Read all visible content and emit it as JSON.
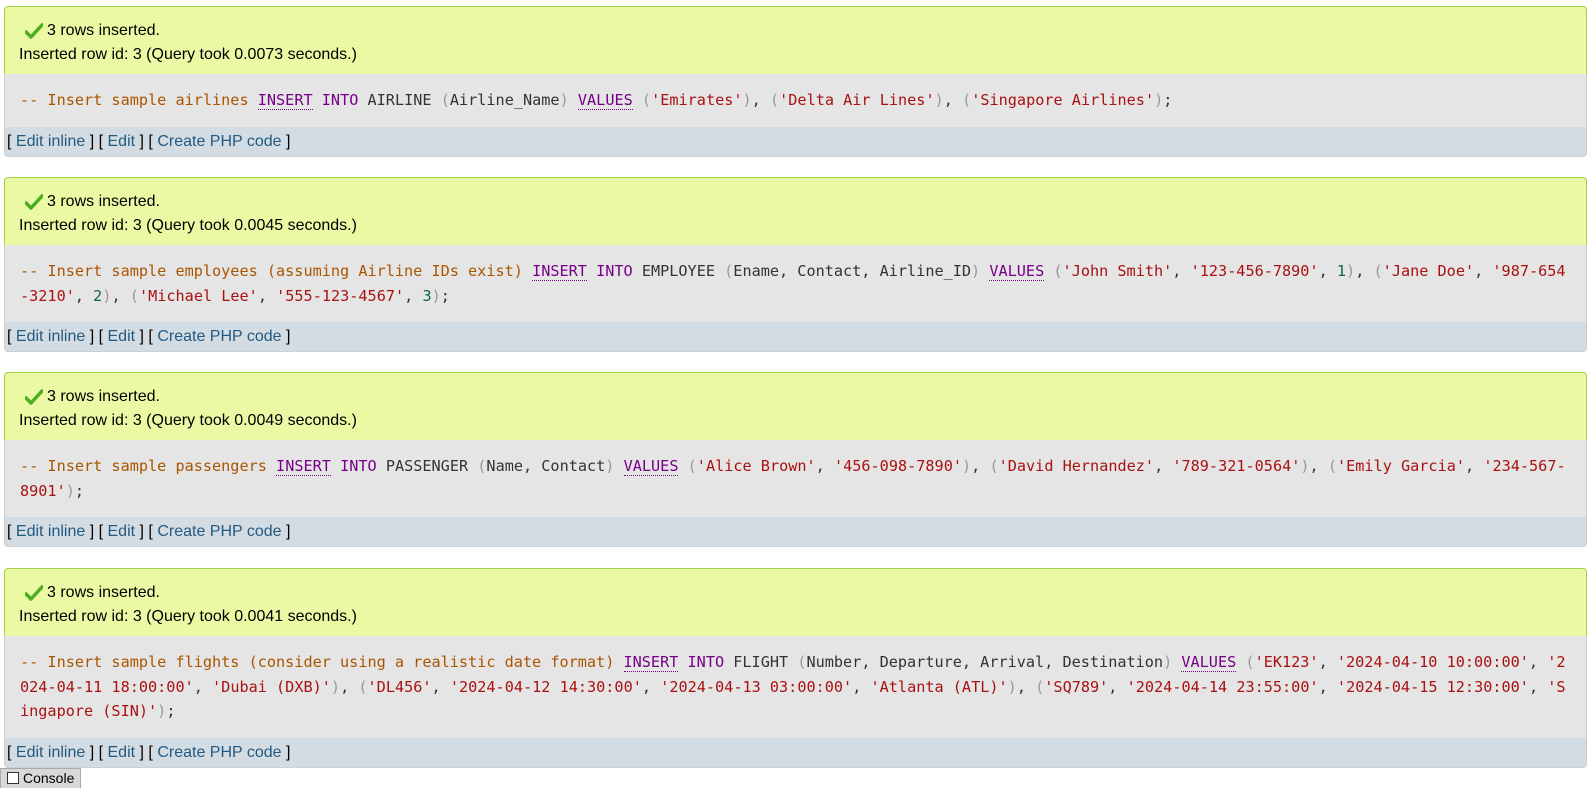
{
  "colors": {
    "success_bg": "#ebf8a4",
    "success_border": "#a2d246",
    "sql_bg": "#e5e5e5",
    "links_bg": "#d3dce3",
    "link": "#235a81",
    "comment": "#aa5500",
    "keyword": "#770088",
    "string": "#aa1111",
    "number": "#116644"
  },
  "results": [
    {
      "message": "3 rows inserted.",
      "detail": "Inserted row id: 3 (Query took 0.0073 seconds.)",
      "sql": {
        "comment": "-- Insert sample airlines",
        "insert": "INSERT",
        "into": "INTO",
        "table": "AIRLINE",
        "columns": "Airline_Name",
        "values_kw": "VALUES",
        "rows": [
          [
            "'Emirates'"
          ],
          [
            "'Delta Air Lines'"
          ],
          [
            "'Singapore Airlines'"
          ]
        ]
      },
      "links": [
        "Edit inline",
        "Edit",
        "Create PHP code"
      ]
    },
    {
      "message": "3 rows inserted.",
      "detail": "Inserted row id: 3 (Query took 0.0045 seconds.)",
      "sql": {
        "comment": "-- Insert sample employees (assuming Airline IDs exist)",
        "insert": "INSERT",
        "into": "INTO",
        "table": "EMPLOYEE",
        "columns": "Ename, Contact, Airline_ID",
        "values_kw": "VALUES",
        "rows": [
          [
            "'John Smith'",
            "'123-456-7890'",
            "1"
          ],
          [
            "'Jane Doe'",
            "'987-654-3210'",
            "2"
          ],
          [
            "'Michael Lee'",
            "'555-123-4567'",
            "3"
          ]
        ]
      },
      "links": [
        "Edit inline",
        "Edit",
        "Create PHP code"
      ]
    },
    {
      "message": "3 rows inserted.",
      "detail": "Inserted row id: 3 (Query took 0.0049 seconds.)",
      "sql": {
        "comment": "-- Insert sample passengers",
        "insert": "INSERT",
        "into": "INTO",
        "table": "PASSENGER",
        "columns": "Name, Contact",
        "values_kw": "VALUES",
        "rows": [
          [
            "'Alice Brown'",
            "'456-098-7890'"
          ],
          [
            "'David Hernandez'",
            "'789-321-0564'"
          ],
          [
            "'Emily Garcia'",
            "'234-567-8901'"
          ]
        ]
      },
      "links": [
        "Edit inline",
        "Edit",
        "Create PHP code"
      ]
    },
    {
      "message": "3 rows inserted.",
      "detail": "Inserted row id: 3 (Query took 0.0041 seconds.)",
      "sql": {
        "comment": "-- Insert sample flights (consider using a realistic date format)",
        "insert": "INSERT",
        "into": "INTO",
        "table": "FLIGHT",
        "columns": "Number, Departure, Arrival, Destination",
        "values_kw": "VALUES",
        "rows": [
          [
            "'EK123'",
            "'2024-04-10 10:00:00'",
            "'2024-04-11 18:00:00'",
            "'Dubai (DXB)'"
          ],
          [
            "'DL456'",
            "'2024-04-12 14:30:00'",
            "'2024-04-13 03:00:00'",
            "'Atlanta (ATL)'"
          ],
          [
            "'SQ789'",
            "'2024-04-14 23:55:00'",
            "'2024-04-15 12:30:00'",
            "'Singapore (SIN)'"
          ]
        ]
      },
      "links": [
        "Edit inline",
        "Edit",
        "Create PHP code"
      ]
    }
  ],
  "console": {
    "label": "Console"
  }
}
